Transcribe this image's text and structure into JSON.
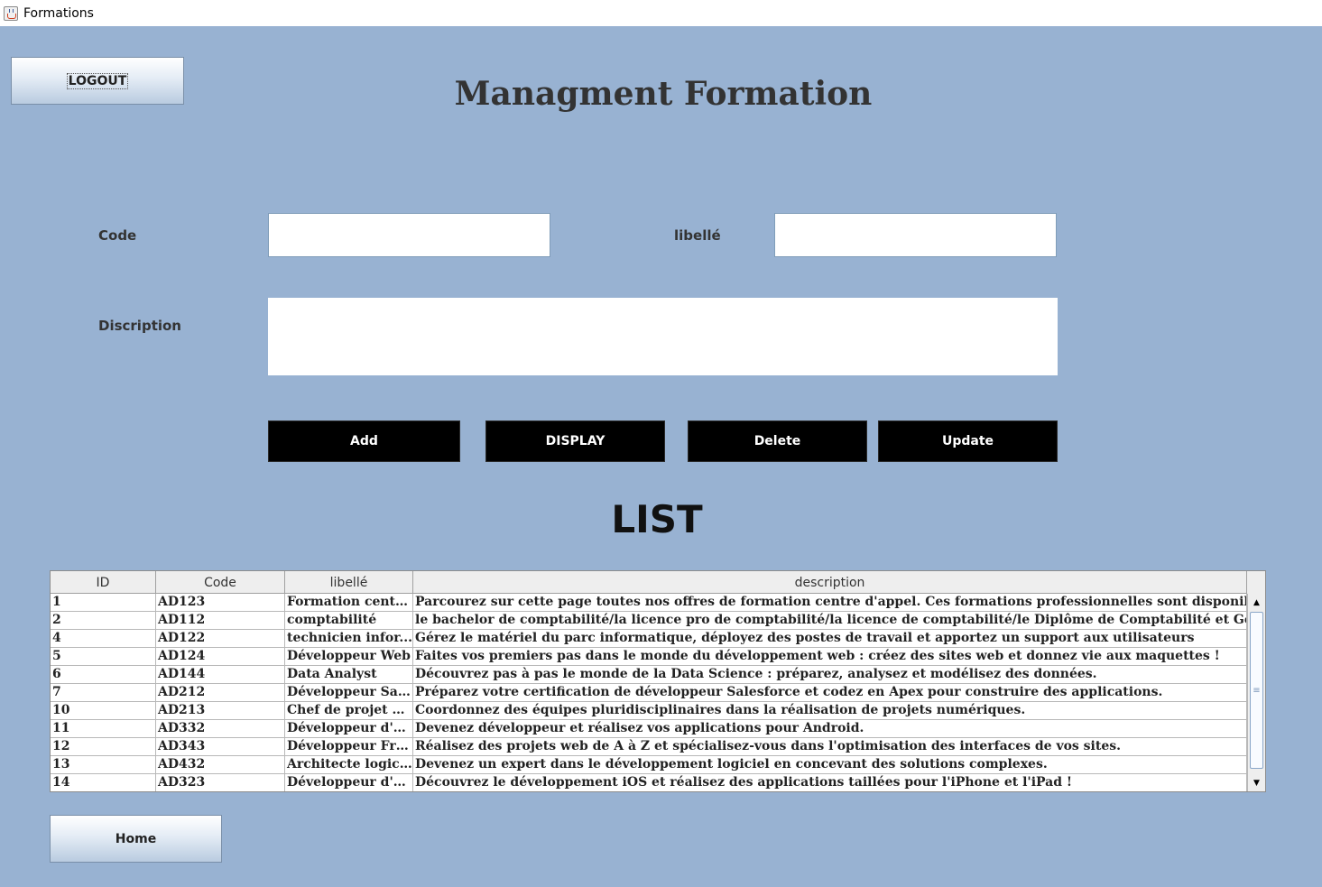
{
  "window": {
    "title": "Formations",
    "icon": "java-coffee-icon"
  },
  "header": {
    "logout_label": "LOGOUT",
    "title": "Managment Formation"
  },
  "form": {
    "code_label": "Code",
    "code_value": "",
    "libelle_label": "libellé",
    "libelle_value": "",
    "description_label": "Discription",
    "description_value": ""
  },
  "actions": {
    "add": "Add",
    "display": "DISPLAY",
    "delete": "Delete",
    "update": "Update"
  },
  "list": {
    "title": "LIST",
    "columns": [
      "ID",
      "Code",
      "libellé",
      "description"
    ],
    "rows": [
      [
        "1",
        "AD123",
        "Formation centr...",
        "Parcourez sur cette page toutes nos offres de formation centre d'appel. Ces formations professionnelles sont disponibles pa"
      ],
      [
        "2",
        "AD112",
        "comptabilité",
        "le bachelor de comptabilité/la licence pro de comptabilité/la licence de comptabilité/le Diplôme de Comptabilité et Gestion"
      ],
      [
        "4",
        "AD122",
        "technicien infor...",
        "Gérez le matériel du parc informatique, déployez des postes de travail et apportez un support aux utilisateurs"
      ],
      [
        "5",
        "AD124",
        "Développeur Web",
        "Faites vos premiers pas dans le monde du développement web : créez des sites web et donnez vie aux maquettes !"
      ],
      [
        "6",
        "AD144",
        "Data Analyst",
        "Découvrez pas à pas le monde de la Data Science : préparez, analysez et modélisez des données."
      ],
      [
        "7",
        "AD212",
        "Développeur Sal...",
        "Préparez votre certification de développeur Salesforce et codez en Apex pour construire des applications."
      ],
      [
        "10",
        "AD213",
        "Chef de projet di...",
        "Coordonnez des équipes pluridisciplinaires dans la réalisation de projets numériques."
      ],
      [
        "11",
        "AD332",
        "Développeur d'a...",
        "Devenez développeur et réalisez vos applications pour Android."
      ],
      [
        "12",
        "AD343",
        "Développeur Fro...",
        "Réalisez des projets web de A à Z et spécialisez-vous dans l'optimisation des interfaces de vos sites."
      ],
      [
        "13",
        "AD432",
        "Architecte logiciel",
        "Devenez un expert dans le développement logiciel en concevant des solutions complexes."
      ],
      [
        "14",
        "AD323",
        "Développeur d'a...",
        "Découvrez le développement iOS et réalisez des applications taillées pour l'iPhone et l'iPad !"
      ]
    ]
  },
  "footer": {
    "home_label": "Home"
  },
  "colors": {
    "background": "#98b2d2",
    "action_button": "#000000",
    "action_text": "#ffffff"
  }
}
